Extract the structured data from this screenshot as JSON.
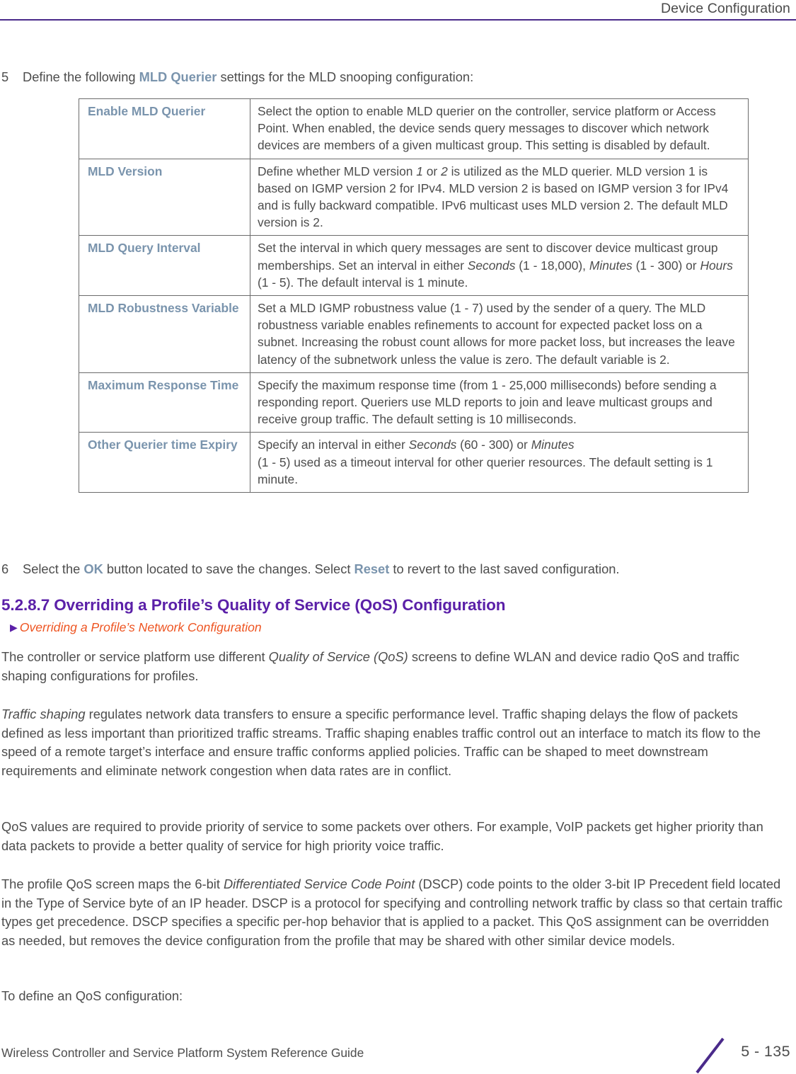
{
  "header": {
    "title": "Device Configuration",
    "rule_color": "#4A2A8A"
  },
  "colors": {
    "ui_term": "#7A94AD",
    "heading": "#5B20A8",
    "xref": "#EE5522",
    "body": "#4D4D4D",
    "table_border": "#6B6B6B"
  },
  "steps": {
    "step5": {
      "number": "5",
      "text_before": "Define the following ",
      "ui_term": "MLD Querier",
      "text_after": " settings for the MLD snooping configuration:"
    },
    "step6": {
      "number": "6",
      "text_before": "Select the ",
      "ui_term_1": "OK",
      "text_middle": " button located to save the changes. Select ",
      "ui_term_2": "Reset",
      "text_after": " to revert to the last saved configuration."
    }
  },
  "param_table": {
    "rows": [
      {
        "label": "Enable MLD Querier",
        "description": "Select the option to enable MLD querier on the controller, service platform or Access Point. When enabled, the device sends query messages to discover which network devices are members of a given multicast group. This setting is disabled by default."
      },
      {
        "label": "MLD Version",
        "description_parts": [
          {
            "text": "Define whether MLD version ",
            "italic": false
          },
          {
            "text": "1",
            "italic": true
          },
          {
            "text": " or ",
            "italic": false
          },
          {
            "text": "2",
            "italic": true
          },
          {
            "text": " is utilized as the MLD querier. MLD version 1 is based on IGMP version 2 for IPv4. MLD version 2 is based on IGMP version 3 for IPv4 and is fully backward compatible. IPv6 multicast uses MLD version 2. The default MLD version is 2.",
            "italic": false
          }
        ]
      },
      {
        "label": "MLD Query Interval",
        "description_parts": [
          {
            "text": "Set the interval in which query messages are sent to discover device multicast group memberships. Set an interval in either ",
            "italic": false
          },
          {
            "text": "Seconds",
            "italic": true
          },
          {
            "text": " (1 - 18,000), ",
            "italic": false
          },
          {
            "text": "Minutes",
            "italic": true
          },
          {
            "text": " (1 - 300) or ",
            "italic": false
          },
          {
            "text": "Hours",
            "italic": true
          },
          {
            "text": " (1 - 5). The default interval is 1 minute.",
            "italic": false
          }
        ]
      },
      {
        "label": "MLD Robustness Variable",
        "description": "Set a MLD IGMP robustness value (1 - 7) used by the sender of a query. The MLD robustness variable enables refinements to account for expected packet loss on a subnet. Increasing the robust count allows for more packet loss, but increases the leave latency of the subnetwork unless the value is zero. The default variable is 2."
      },
      {
        "label": "Maximum Response Time",
        "description": "Specify the maximum response time (from 1 - 25,000 milliseconds) before sending a responding report. Queriers use MLD reports to join and leave multicast groups and receive group traffic. The default setting is 10 milliseconds."
      },
      {
        "label": "Other Querier time Expiry",
        "description_parts": [
          {
            "text": "Specify an interval in either ",
            "italic": false
          },
          {
            "text": "Seconds",
            "italic": true
          },
          {
            "text": " (60 - 300) or ",
            "italic": false
          },
          {
            "text": "Minutes",
            "italic": true
          },
          {
            "text": "\n(1 - 5) used as a timeout interval for other querier resources. The default setting is 1 minute.",
            "italic": false
          }
        ]
      }
    ]
  },
  "section": {
    "heading": "5.2.8.7 Overriding a Profile’s Quality of Service (QoS) Configuration",
    "xref": "Overriding a Profile’s Network Configuration",
    "xref_arrow": "▶"
  },
  "paragraphs": {
    "p1_parts": [
      {
        "text": "The controller or service platform use different ",
        "italic": false
      },
      {
        "text": "Quality of Service (QoS)",
        "italic": true
      },
      {
        "text": " screens to define WLAN and device radio QoS and traffic shaping configurations for profiles.",
        "italic": false
      }
    ],
    "p2_parts": [
      {
        "text": "Traffic shaping",
        "italic": true
      },
      {
        "text": " regulates network data transfers to ensure a specific performance level. Traffic shaping delays the flow of packets defined as less important than prioritized traffic streams. Traffic shaping enables traffic control out an interface to match its flow to the speed of a remote target’s interface and ensure traffic conforms applied policies. Traffic can be shaped to meet downstream requirements and eliminate network congestion when data rates are in conflict.",
        "italic": false
      }
    ],
    "p3_parts": [
      {
        "text": "QoS values are required to provide priority of service to some packets over others. For example, VoIP packets get higher priority than data packets to provide a better quality of service for high priority voice traffic.",
        "italic": false
      }
    ],
    "p4_parts": [
      {
        "text": "The profile QoS screen maps the 6-bit ",
        "italic": false
      },
      {
        "text": "Differentiated Service Code Point",
        "italic": true
      },
      {
        "text": " (DSCP) code points to the older 3-bit IP Precedent field located in the Type of Service byte of an IP header. DSCP is a protocol for specifying and controlling network traffic by class so that certain traffic types get precedence. DSCP specifies a specific per-hop behavior that is applied to a packet. This QoS assignment can be overridden as needed, but removes the device configuration from the profile that may be shared with other similar device models.",
        "italic": false
      }
    ],
    "p5_parts": [
      {
        "text": "To define an QoS configuration:",
        "italic": false
      }
    ]
  },
  "footer": {
    "guide_title": "Wireless Controller and Service Platform System Reference Guide",
    "page_number": "5 - 135",
    "slash_color": "#4A2A8A"
  }
}
